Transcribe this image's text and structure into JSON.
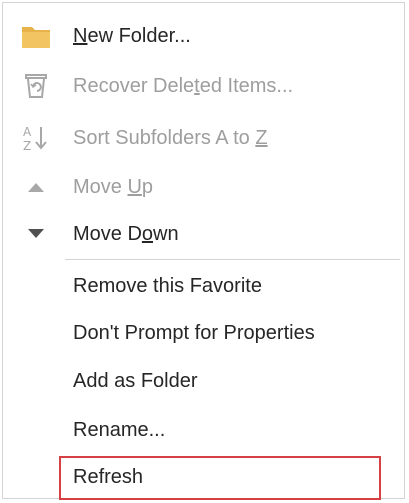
{
  "menu": {
    "items": [
      {
        "id": "new-folder",
        "pre": "",
        "key": "N",
        "post": "ew Folder...",
        "disabled": false,
        "icon": "folder-icon"
      },
      {
        "id": "recover-deleted-items",
        "pre": "Recover Dele",
        "key": "t",
        "post": "ed Items...",
        "disabled": true,
        "icon": "recycle-bin-icon"
      },
      {
        "id": "sort-subfolders",
        "pre": "Sort Subfolders A to ",
        "key": "Z",
        "post": "",
        "disabled": true,
        "icon": "sort-az-icon"
      },
      {
        "id": "move-up",
        "pre": "Move ",
        "key": "U",
        "post": "p",
        "disabled": true,
        "icon": "triangle-up-icon"
      },
      {
        "id": "move-down",
        "pre": "Move D",
        "key": "o",
        "post": "wn",
        "disabled": false,
        "icon": "triangle-down-icon"
      },
      {
        "id": "remove-favorite",
        "pre": "Remove this Favorite",
        "key": "",
        "post": "",
        "disabled": false
      },
      {
        "id": "dont-prompt",
        "pre": "Don't Prompt for Properties",
        "key": "",
        "post": "",
        "disabled": false
      },
      {
        "id": "add-as-folder",
        "pre": "Add as Folder",
        "key": "",
        "post": "",
        "disabled": false
      },
      {
        "id": "rename",
        "pre": "Rename...",
        "key": "",
        "post": "",
        "disabled": false
      },
      {
        "id": "refresh",
        "pre": "Refresh",
        "key": "",
        "post": "",
        "disabled": false,
        "highlighted": true
      }
    ]
  },
  "colors": {
    "folder": "#e8b24a",
    "disabled_icon": "#a8a8a8",
    "enabled_icon": "#505050",
    "highlight_border": "#d64045"
  }
}
